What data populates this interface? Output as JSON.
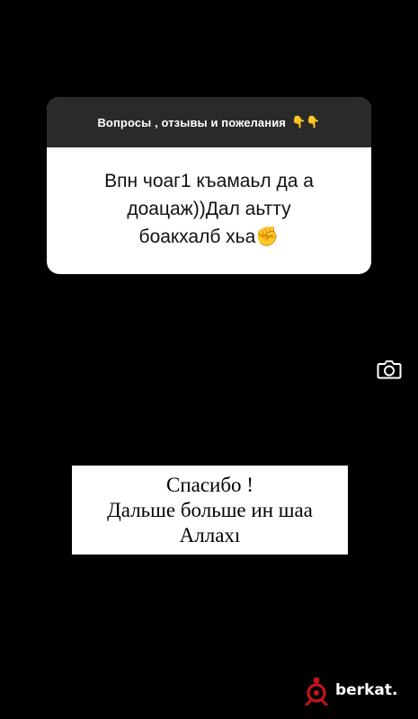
{
  "question_card": {
    "header_text": "Вопросы , отзывы и пожелания",
    "header_emoji": "👇👇",
    "answer_text": "Впн чоаг1 къамаьл да а\nдоацаж))Дал аьтту\nбоакхалб хьа✊"
  },
  "camera": {
    "icon": "camera-icon"
  },
  "reply": {
    "text": "Спасибо !\nДальше больше ин шаа\nАллахı"
  },
  "watermark": {
    "text": "berkat.",
    "accent_color": "#c0151b"
  }
}
